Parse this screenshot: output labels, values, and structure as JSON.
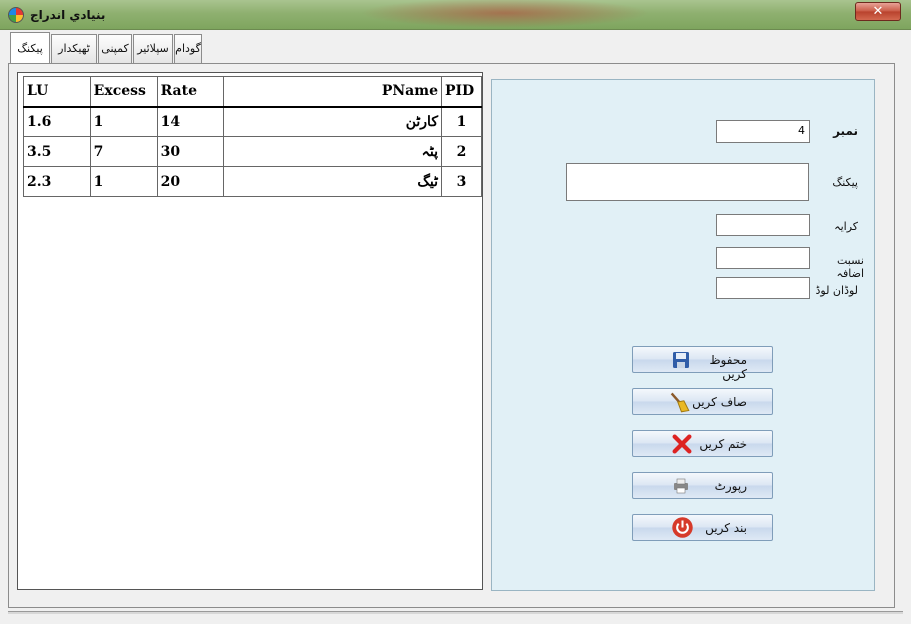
{
  "window": {
    "title": "بنيادي اندراج",
    "close_glyph": "✕"
  },
  "tabs": [
    {
      "label": "پیکنگ",
      "active": true
    },
    {
      "label": "ٹھیکدار",
      "active": false
    },
    {
      "label": "کمپنی",
      "active": false
    },
    {
      "label": "سپلائیر",
      "active": false
    },
    {
      "label": "گودام",
      "active": false
    }
  ],
  "grid": {
    "columns": [
      "LU",
      "Excess",
      "Rate",
      "PName",
      "PID"
    ],
    "rows": [
      [
        "1.6",
        "1",
        "14",
        "کارٹن",
        "1"
      ],
      [
        "3.5",
        "7",
        "30",
        "پٹہ",
        "2"
      ],
      [
        "2.3",
        "1",
        "20",
        "ٹیگ",
        "3"
      ]
    ]
  },
  "form": {
    "number_label": "نمبر",
    "number_value": "4",
    "packing_label": "پیکنگ",
    "rent_label": "کرایہ",
    "ratio_label": "نسبت اضافہ",
    "loading_label": "لوڈان لوڈ"
  },
  "buttons": {
    "save": "محفوظ کریں",
    "clear": "صاف کریں",
    "delete": "ختم کریں",
    "report": "رپورٹ",
    "close": "بند کریں"
  },
  "icons": {
    "app": "app-logo-icon",
    "save": "floppy-disk-icon",
    "clear": "broom-icon",
    "delete": "red-x-icon",
    "report": "printer-icon",
    "close": "power-icon"
  },
  "colors": {
    "titlebar": "#8fb070",
    "panel": "#e1f0f6",
    "close_button": "#c95a44"
  }
}
